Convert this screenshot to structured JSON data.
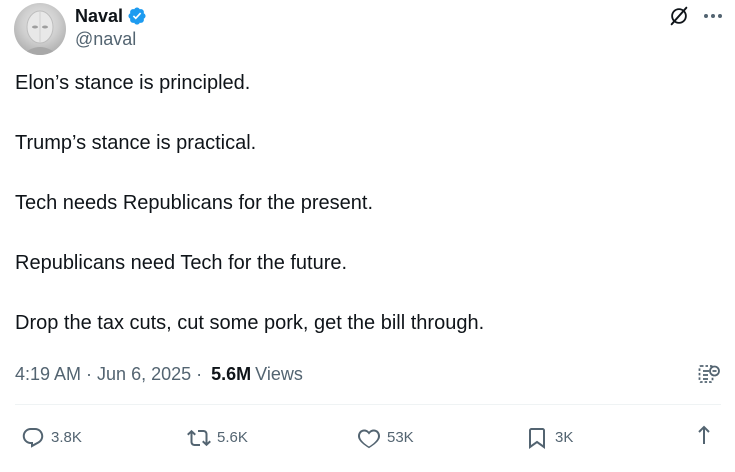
{
  "author": {
    "name": "Naval",
    "handle": "@naval",
    "verified": true
  },
  "post": {
    "paragraphs": [
      "Elon’s stance is principled.",
      "Trump’s stance is practical.",
      "Tech needs Republicans for the present.",
      "Republicans need Tech for the future.",
      "Drop the tax cuts, cut some pork, get the bill through."
    ],
    "time": "4:19 AM",
    "date": "Jun 6, 2025",
    "views_count": "5.6M",
    "views_label": "Views"
  },
  "actions": {
    "replies": "3.8K",
    "reposts": "5.6K",
    "likes": "53K",
    "bookmarks": "3K"
  },
  "colors": {
    "text": "#0f1419",
    "secondary": "#536471",
    "verified": "#1d9bf0",
    "divider": "#eff3f4"
  },
  "icons": [
    "verified-badge-icon",
    "grok-icon",
    "more-icon",
    "community-notes-icon",
    "reply-icon",
    "repost-icon",
    "like-icon",
    "bookmark-icon",
    "share-icon"
  ]
}
